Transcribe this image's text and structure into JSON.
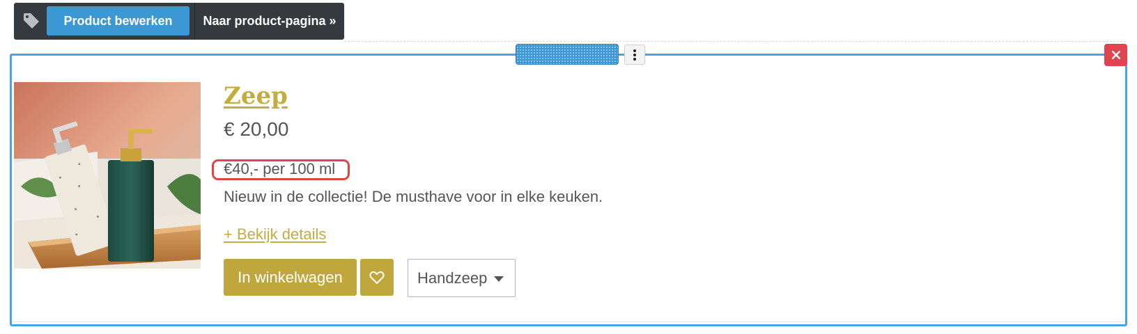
{
  "toolbar": {
    "icon": "tag-icon",
    "edit_label": "Product bewerken",
    "page_label": "Naar product-pagina »"
  },
  "block_controls": {
    "drag_icon": "drag-handle",
    "menu_icon": "kebab-menu-icon",
    "close_icon": "close-icon"
  },
  "product": {
    "title": "Zeep",
    "price": "€ 20,00",
    "unit_price": "€40,- per 100 ml",
    "description": "Nieuw in de collectie! De musthave voor in elke keuken.",
    "details_link": "+ Bekijk details",
    "cart_label": "In winkelwagen",
    "wishlist_icon": "heart-icon",
    "variant_selected": "Handzeep"
  },
  "colors": {
    "accent_gold": "#bfa73e",
    "selection_blue": "#46a6e3",
    "toolbar_dark": "#353a3f",
    "edit_button_blue": "#3c98d2",
    "close_red": "#e0444f",
    "highlight_red": "#dd4444"
  }
}
